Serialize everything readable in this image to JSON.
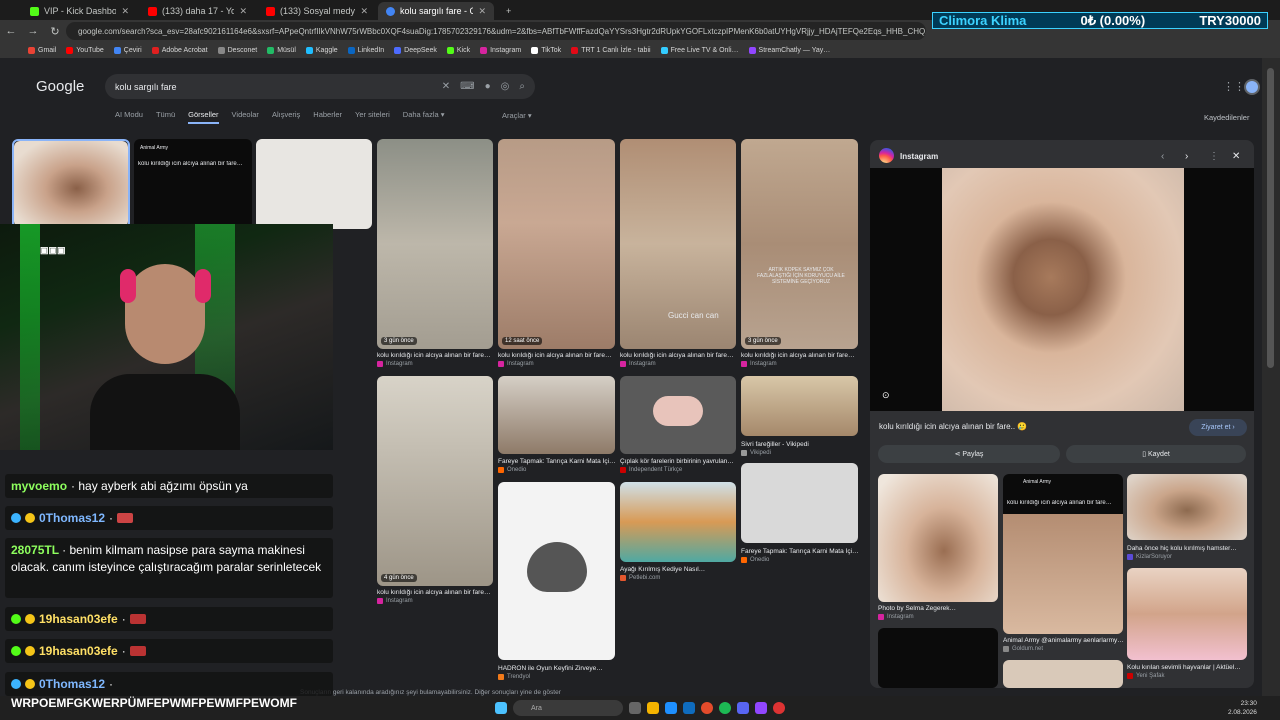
{
  "browser": {
    "tabs": [
      {
        "label": "VIP - Kick Dashboard",
        "fav": "#53fc18",
        "active": false
      },
      {
        "label": "(133) daha 17 - YouTube",
        "fav": "#ff0000",
        "active": false
      },
      {
        "label": "(133) Sosyal medyada görüştü…",
        "fav": "#ff0000",
        "active": false
      },
      {
        "label": "kolu sargılı fare - Google'da Ara",
        "fav": "#4285f4",
        "active": true
      }
    ],
    "url": "google.com/search?sca_esv=28afc902161164e6&sxsrf=APpeQntrfIIkVNhW75rWBbc0XQF4suaDig:1785702329176&udm=2&fbs=ABfTbFWffFazdQaYYSrs3Hgtr2dRUpkYGOFLxtczpIPMenK6b0atUYHgVRjjy_HDAjTEFQe2Eqs_HHB_CHQZ-HeojrWNWs_rr5fVuqgSFSUL6ebeVFZE2X-EvDfcVV0Ky4kcFDdm9AfSuc6yjMicrioTsIagfo6qiwKWUsL77hXHL2u5YzeOs…",
    "bookmarks": [
      "Gmail",
      "YouTube",
      "Çeviri",
      "Adobe Acrobat",
      "Desconet",
      "Müsül",
      "Kaggle",
      "LinkedIn",
      "DeepSeek",
      "Kick",
      "Instagram",
      "TikTok",
      "TRT 1 Canlı İzle - tabii",
      "Free Live TV & Onli…",
      "StreamChatly — Yay…"
    ]
  },
  "ticker": {
    "name": "Climora Klima",
    "value": "0₺ (0.00%)",
    "total": "TRY30000"
  },
  "google": {
    "logo": "Google",
    "query": "kolu sargılı fare",
    "tabs": [
      "AI Modu",
      "Tümü",
      "Görseller",
      "Videolar",
      "Alışveriş",
      "Haberler",
      "Yer siteleri",
      "Daha fazla ▾"
    ],
    "active_tab": "Görseller",
    "tools": "Araçlar ▾",
    "saved": "Kaydedilenler"
  },
  "results": [
    {
      "caption": "kolu kırıldığı icin alcıya alınan bir fare…",
      "source": "Instagram",
      "badge": "3 gün önce"
    },
    {
      "caption": "kolu kırıldığı icin alcıya alınan bir fare…",
      "source": "Instagram",
      "badge": "12 saat önce"
    },
    {
      "caption": "kolu kırıldığı icin alcıya alınan bir fare…",
      "source": "Instagram",
      "badge": ""
    },
    {
      "caption": "kolu kırıldığı icin alcıya alınan bir fare…",
      "source": "Instagram",
      "badge": "3 gün önce"
    },
    {
      "caption": "Fareye Tapmak: Tanrıça Karni Mata İçi…",
      "source": "Onedio",
      "badge": ""
    },
    {
      "caption": "Çıplak kör farelerin birbirinin yavrulan…",
      "source": "Independent Türkçe",
      "badge": ""
    },
    {
      "caption": "Sivri fareğiller - Vikipedi",
      "source": "Vikipedi",
      "badge": ""
    },
    {
      "caption": "kolu kırıldığı icin alcıya alınan bir fare…",
      "source": "Instagram",
      "badge": "4 gün önce"
    },
    {
      "caption": "Ayağı Kırılmış Kediye Nasıl…",
      "source": "Petlebi.com",
      "badge": ""
    },
    {
      "caption": "Fareye Tapmak: Tanrıça Karni Mata İçi…",
      "source": "Onedio",
      "badge": ""
    },
    {
      "caption": "HADRON ile Oyun Keyfini Zirveye…",
      "source": "Trendyol",
      "badge": ""
    }
  ],
  "overlay_texts": {
    "animal_army": "Animal Army",
    "card_caption": "kolu kırıldığı icin alcıya alınan bir fare…",
    "gucci": "Gucci can can",
    "tile2_text": "ARTIK KÖPEK SAYMIZ ÇOK FAZLALAŞTIĞI İÇİN KORUYUCU AİLE SİSTEMİNE GEÇİYORUZ"
  },
  "panel": {
    "source": "Instagram",
    "title": "kolu kırıldığı icin alcıya alınan bir fare.. 🥲",
    "visit": "Ziyaret et ›",
    "share": "Paylaş",
    "save": "Kaydet",
    "related": [
      {
        "caption": "Photo by Selma Zegerek…",
        "source": "Instagram"
      },
      {
        "caption": "Animal Army @animalarmy aenlarlarmy…",
        "source": "Goldum.net"
      },
      {
        "caption": "Daha önce hiç kolu kırılmış hamster…",
        "source": "KizlarSoruyor"
      },
      {
        "caption": "Kolu kırılan sevimli hayvanlar | Aktüel…",
        "source": "Yeni Şafak"
      }
    ]
  },
  "chat": [
    {
      "user": "myvoemo",
      "msg": "· hay ayberk abi ağzımı öpsün ya",
      "color": "g"
    },
    {
      "user": "0Thomas12",
      "msg": "·",
      "color": ""
    },
    {
      "user": "28075TL",
      "msg": "· benim kilmam nasipse para sayma makinesi olacak. canım isteyince çalıştıracağım paralar serinletecek",
      "color": "g"
    },
    {
      "user": "19hasan03efe",
      "msg": "·",
      "color": "y"
    },
    {
      "user": "19hasan03efe",
      "msg": "·",
      "color": "y"
    },
    {
      "user": "0Thomas12",
      "msg": "·",
      "color": ""
    },
    {
      "user": "",
      "msg": "WRPOEMFGKWERPÜMFEPWMFPEWMFPEWOMF",
      "color": ""
    }
  ],
  "taskbar": {
    "search": "Ara",
    "time": "23:30",
    "date": "2.08.2026"
  },
  "bottom_note": "Sonuçların geri kalanında aradığınız şeyi bulamayabilirsiniz. Diğer sonuçları yine de göster"
}
